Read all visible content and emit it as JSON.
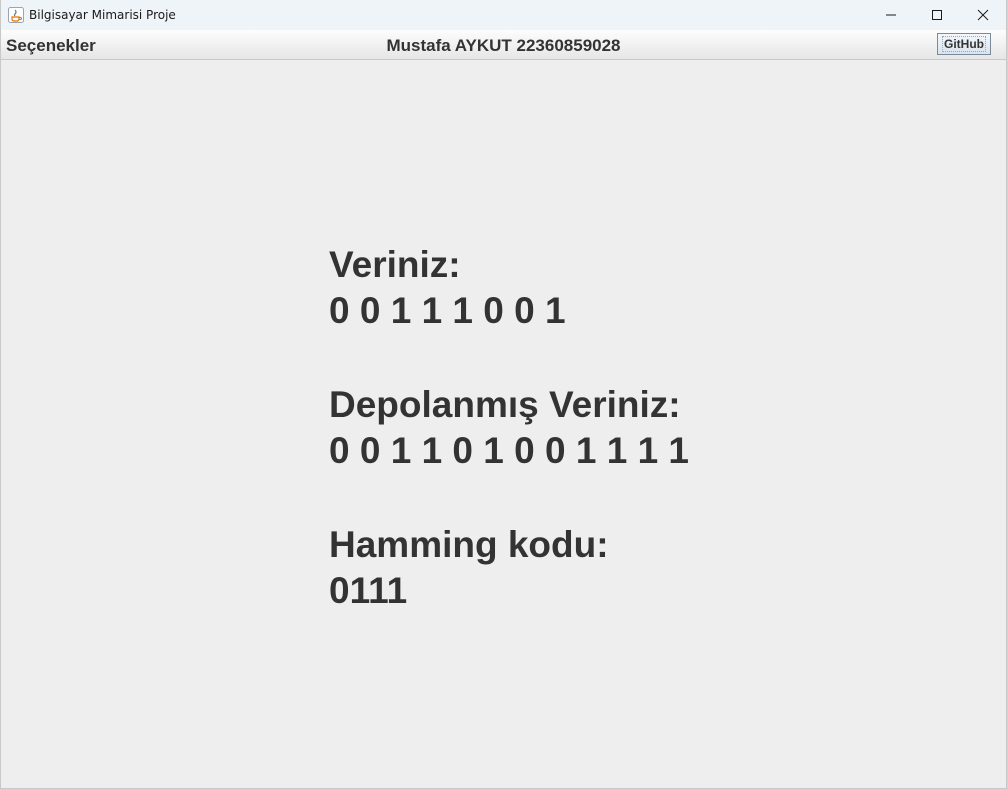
{
  "window": {
    "title": "Bilgisayar Mimarisi Proje",
    "icon": "java-icon"
  },
  "menubar": {
    "options_label": "Seçenekler",
    "author_label": "Mustafa AYKUT 22360859028",
    "github_label": "GitHub"
  },
  "main": {
    "data_heading": "Veriniz:",
    "data_value": "0 0 1 1 1 0 0 1",
    "stored_heading": "Depolanmış Veriniz:",
    "stored_value": "0 0 1 1 0 1 0 0 1 1 1 1",
    "hamming_heading": "Hamming kodu:",
    "hamming_value": "0111"
  }
}
